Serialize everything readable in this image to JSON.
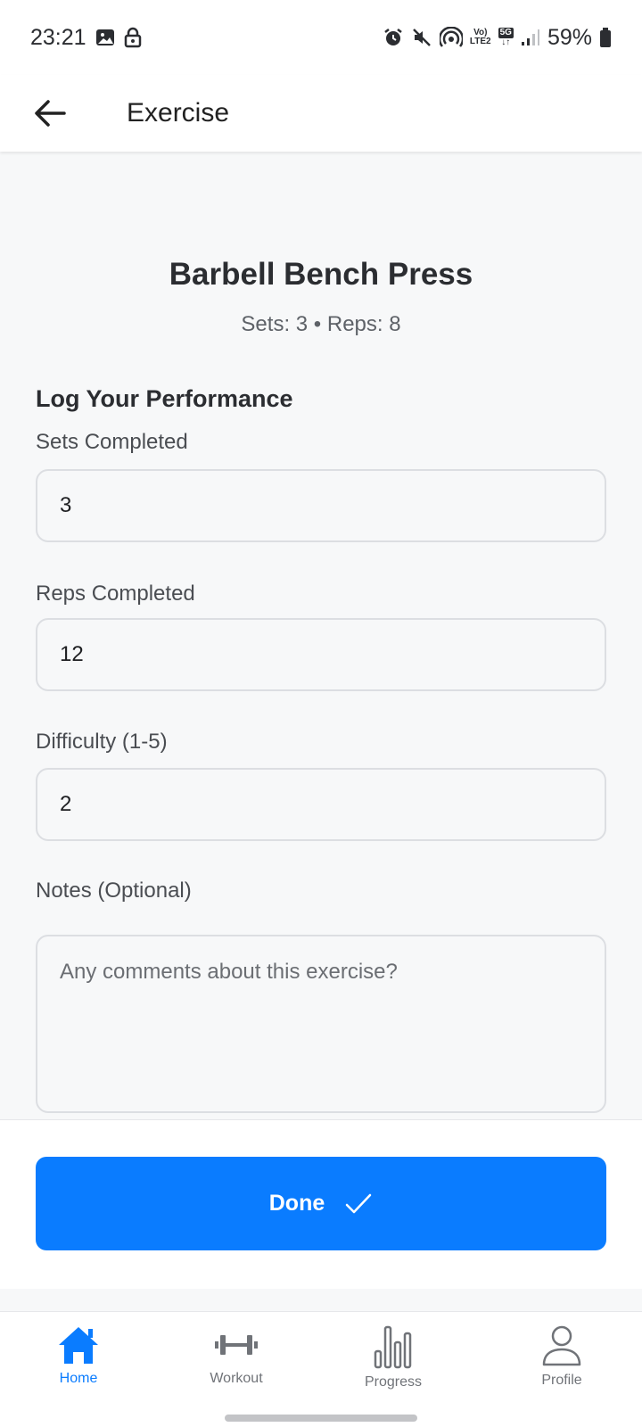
{
  "status_bar": {
    "time": "23:21",
    "battery": "59%",
    "net_top": "Vo)",
    "net_bottom": "LTE2",
    "net_5g": "5G",
    "left_icons": [
      "image-icon",
      "lock-icon"
    ],
    "right_icons": [
      "alarm-icon",
      "mute-icon",
      "hotspot-icon",
      "signal-icon",
      "battery-icon"
    ]
  },
  "app_bar": {
    "title": "Exercise"
  },
  "exercise": {
    "name": "Barbell Bench Press",
    "summary": "Sets: 3 • Reps: 8"
  },
  "form": {
    "section_title": "Log Your Performance",
    "sets_label": "Sets Completed",
    "sets_value": "3",
    "reps_label": "Reps Completed",
    "reps_value": "12",
    "difficulty_label": "Difficulty (1-5)",
    "difficulty_value": "2",
    "notes_label": "Notes (Optional)",
    "notes_placeholder": "Any comments about this exercise?"
  },
  "done_button": {
    "label": "Done",
    "icon": "check-icon"
  },
  "bottom_nav": {
    "items": [
      {
        "label": "Home",
        "icon": "home-icon",
        "active": true
      },
      {
        "label": "Workout",
        "icon": "dumbbell-icon",
        "active": false
      },
      {
        "label": "Progress",
        "icon": "bar-chart-icon",
        "active": false
      },
      {
        "label": "Profile",
        "icon": "person-icon",
        "active": false
      }
    ]
  },
  "colors": {
    "accent": "#0a7cff",
    "background": "#f7f8f9",
    "text": "#2b2d31"
  }
}
